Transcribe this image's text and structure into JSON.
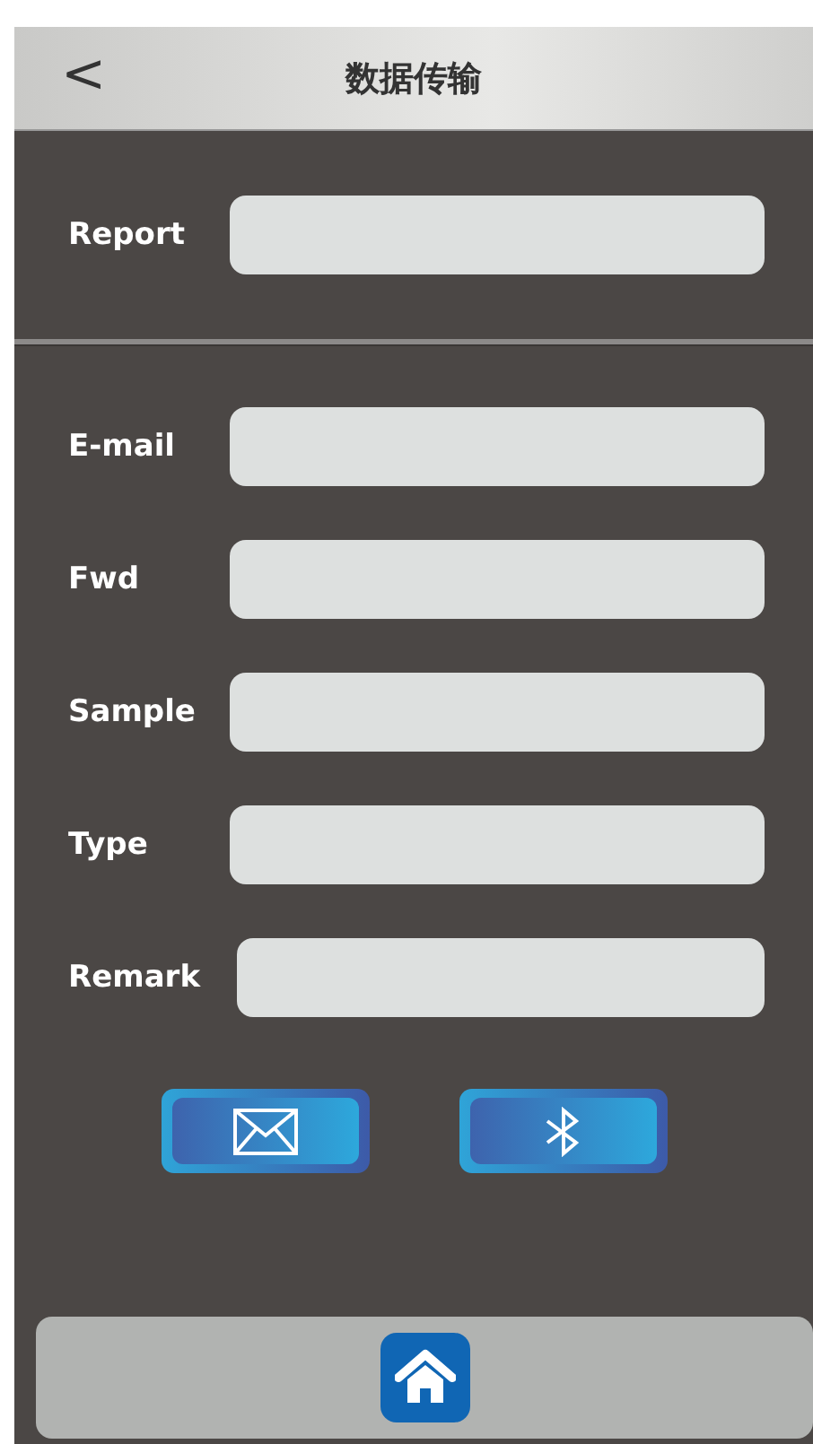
{
  "header": {
    "back": "<",
    "title": "数据传输"
  },
  "report": {
    "label": "Report"
  },
  "fields": [
    {
      "label": "E-mail"
    },
    {
      "label": "Fwd"
    },
    {
      "label": "Sample"
    },
    {
      "label": "Type"
    },
    {
      "label": "Remark"
    }
  ],
  "actions": [
    {
      "kind": "email"
    },
    {
      "kind": "bluetooth"
    }
  ],
  "footer": {
    "kind": "home"
  }
}
